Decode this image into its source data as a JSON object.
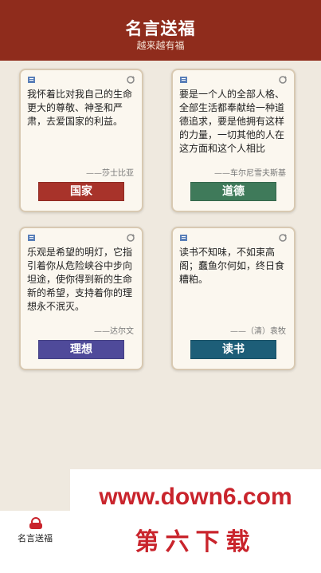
{
  "header": {
    "title": "名言送福",
    "subtitle": "越来越有福"
  },
  "cards": [
    {
      "quote": "我怀着比对我自己的生命更大的尊敬、神圣和严肃，去爱国家的利益。",
      "author": "——莎士比亚",
      "button": "国家",
      "color": "#a8332a"
    },
    {
      "quote": "要是一个人的全部人格、全部生活都奉献给一种道德追求，要是他拥有这样的力量，一切其他的人在这方面和这个人相比",
      "author": "——车尔尼雪夫斯基",
      "button": "道德",
      "color": "#3f7a5a"
    },
    {
      "quote": "乐观是希望的明灯，它指引着你从危险峡谷中步向坦途，使你得到新的生命新的希望，支持着你的理想永不泯灭。",
      "author": "——达尔文",
      "button": "理想",
      "color": "#4f4a9a"
    },
    {
      "quote": "读书不知味，不如束高阁；蠢鱼尔何如，终日食糟粕。",
      "author": "——（清）袁牧",
      "button": "读书",
      "color": "#1d5e78"
    }
  ],
  "watermark": {
    "url": "www.down6.com",
    "name": "第六下载"
  },
  "tabbar": {
    "label": "名言送福",
    "icon": "app-icon"
  }
}
